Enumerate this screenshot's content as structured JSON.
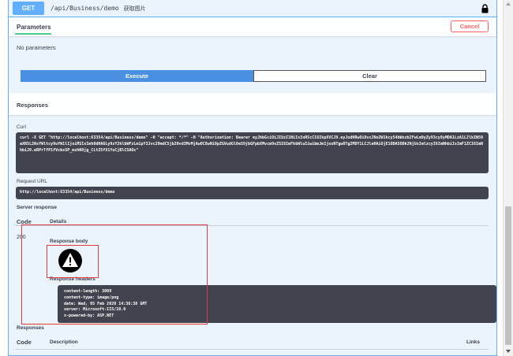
{
  "summary": {
    "method": "GET",
    "path": "/api/Business/demo",
    "description": "获取图片",
    "lock_icon": "lock-icon"
  },
  "parameters": {
    "tab_label": "Parameters",
    "cancel_label": "Cancel",
    "empty_text": "No parameters"
  },
  "actions": {
    "execute_label": "Execute",
    "clear_label": "Clear"
  },
  "responses_section": {
    "title": "Responses",
    "curl_label": "Curl",
    "curl_command": "curl -X GET \"http://localhost:63354/api/Business/demo\" -H \"accept: */*\" -H \"Authorization: Bearer eyJhbGciOiJIUzI1NiIsInR5cCI6IkpXVCJ9.eyJodHRwOi8vc2NoZW1hcy54bWxzb2FwLm9yZy93cy8yMDA1LzA1L2lkZW50aXR5L2NsYWltcy9uYW1lIjoiMSIsImh0dHA6Ly9zY2hlbWFzLm1pY3Jvc29mdC5jb20vd3MvMjAwOC8wNi9pZGVudGl0eS9jbGFpbXMvcm9sZSI6ImFkbWluIiwibmJmIjoxNTgwOTg2MDY1LCJleHAiOjE1ODA5ODk2NjUsImlzcyI6ImNhbiIsImF1ZCI6ImNhbiJ9.eRPrTfP1fVcbsSP_mzhN9jg_CLtZ5fX1YuCjBlCSAOc\"",
    "request_url_label": "Request URL",
    "request_url": "http://localhost:63354/api/Business/demo",
    "server_response_label": "Server response",
    "code_header": "Code",
    "details_header": "Details",
    "status_code": "200",
    "response_body_label": "Response body",
    "warning_icon": "warning-icon",
    "response_headers_label": "Response headers",
    "response_headers": [
      "content-length: 3009",
      "content-type: image/png",
      "date: Wed, 05 Feb 2020 14:36:38 GMT",
      "server: Microsoft-IIS/10.0",
      "x-powered-by: ASP.NET"
    ]
  },
  "responses_table": {
    "title": "Responses",
    "code_header": "Code",
    "description_header": "Description",
    "links_header": "Links"
  },
  "colors": {
    "get_blue": "#61affe",
    "execute_blue": "#4990e2",
    "cancel_red": "#ff6060",
    "highlight_red": "#e0393e",
    "code_bg": "#41444e"
  }
}
